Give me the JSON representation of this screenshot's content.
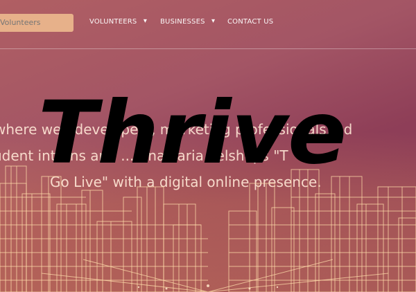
{
  "header": {
    "search_placeholder": "Volunteers",
    "nav": [
      {
        "label": "VOLUNTEERS"
      },
      {
        "label": "BUSINESSES"
      },
      {
        "label": "CONTACT US"
      }
    ]
  },
  "hero": {
    "logo_text": "Thrive",
    "line1": "where web developers, marketing professionals, ed",
    "line2": "udent interns and ... AnaMaria Pelshops \"T",
    "line3": "Go Live\" with a digital online presence."
  },
  "colors": {
    "accent": "#e7b18a",
    "logo": "#000000"
  }
}
